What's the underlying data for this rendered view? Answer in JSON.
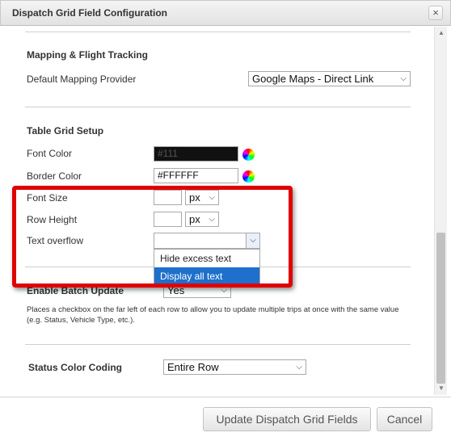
{
  "dialog": {
    "title": "Dispatch Grid Field Configuration",
    "close_glyph": "×"
  },
  "mapping": {
    "section_title": "Mapping & Flight Tracking",
    "provider_label": "Default Mapping Provider",
    "provider_value": "Google Maps - Direct Link"
  },
  "table_grid": {
    "section_title": "Table Grid Setup",
    "font_color_label": "Font Color",
    "font_color_value": "#111",
    "border_color_label": "Border Color",
    "border_color_value": "#FFFFFF",
    "font_size_label": "Font Size",
    "font_size_value": "",
    "font_size_unit": "px",
    "row_height_label": "Row Height",
    "row_height_value": "",
    "row_height_unit": "px",
    "text_overflow_label": "Text overflow",
    "text_overflow_value": "",
    "text_overflow_options": [
      "Hide excess text",
      "Display all text"
    ]
  },
  "batch_update": {
    "label": "Enable Batch Update",
    "value": "Yes",
    "help": "Places a checkbox on the far left of each row to allow you to update multiple trips at once with the same value (e.g. Status, Vehicle Type, etc.)."
  },
  "status_coding": {
    "label": "Status Color Coding",
    "value": "Entire Row"
  },
  "footer": {
    "update_label": "Update Dispatch Grid Fields",
    "cancel_label": "Cancel"
  },
  "colors": {
    "highlight": "#e00000",
    "dropdown_selected": "#1e70cc"
  },
  "icons": {
    "close": "close-icon",
    "chevron": "chevron-down-icon",
    "color_picker": "color-wheel-icon"
  }
}
